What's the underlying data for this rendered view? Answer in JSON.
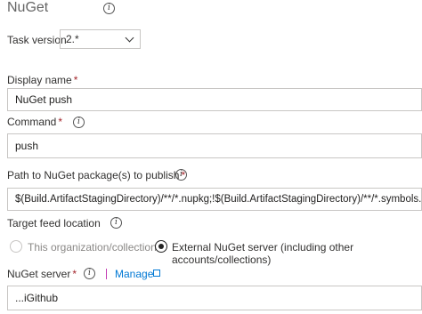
{
  "task": {
    "title": "NuGet"
  },
  "task_version": {
    "label": "Task version",
    "value": "2.*"
  },
  "display_name": {
    "label": "Display name",
    "required": "*",
    "value": "NuGet push"
  },
  "command": {
    "label": "Command",
    "required": "*",
    "value": "push"
  },
  "path": {
    "label": "Path to NuGet package(s) to publish",
    "required": "*",
    "value": "$(Build.ArtifactStagingDirectory)/**/*.nupkg;!$(Build.ArtifactStagingDirectory)/**/*.symbols.nupkg"
  },
  "target_feed": {
    "label": "Target feed location",
    "options": [
      {
        "label": "This organization/collection",
        "selected": false
      },
      {
        "label": "External NuGet server (including other accounts/collections)",
        "selected": true
      }
    ]
  },
  "nuget_server": {
    "label": "NuGet server",
    "required": "*",
    "manage_label": "Manage",
    "value": "...iGithub"
  },
  "icons": {
    "info": "info-icon",
    "external": "external-link-icon",
    "chevron": "chevron-down-icon"
  },
  "colors": {
    "link": "#0078d4",
    "required": "#a4262c",
    "border": "#c8c6c4"
  }
}
